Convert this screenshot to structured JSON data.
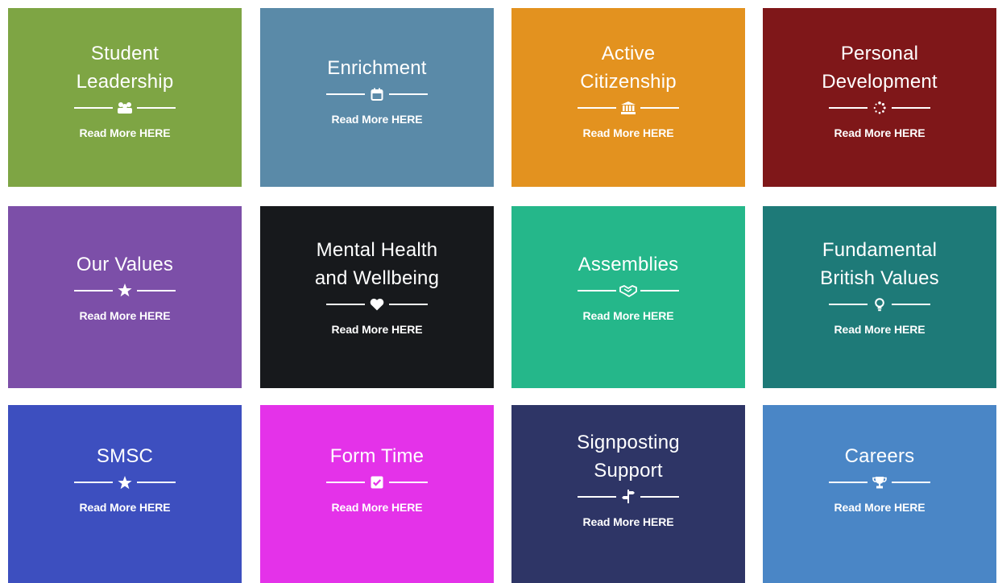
{
  "tiles": [
    {
      "title_lines": [
        "Student",
        "Leadership"
      ],
      "icon": "people-icon",
      "link": "Read More HERE",
      "color": "#7EA544"
    },
    {
      "title_lines": [
        "Enrichment"
      ],
      "icon": "calendar-icon",
      "link": "Read More HERE",
      "color": "#5A8AA8"
    },
    {
      "title_lines": [
        "Active",
        "Citizenship"
      ],
      "icon": "bank-icon",
      "link": "Read More HERE",
      "color": "#E3921F"
    },
    {
      "title_lines": [
        "Personal",
        "Development"
      ],
      "icon": "spinner-icon",
      "link": "Read More HERE",
      "color": "#7F1719"
    },
    {
      "title_lines": [
        "Our Values"
      ],
      "icon": "star-icon",
      "link": "Read More HERE",
      "color": "#7C4FA8"
    },
    {
      "title_lines": [
        "Mental Health",
        "and Wellbeing"
      ],
      "icon": "heart-icon",
      "link": "Read More HERE",
      "color": "#17191C"
    },
    {
      "title_lines": [
        "Assemblies"
      ],
      "icon": "handshake-icon",
      "link": "Read More HERE",
      "color": "#25B78A"
    },
    {
      "title_lines": [
        "Fundamental",
        "British Values"
      ],
      "icon": "lightbulb-icon",
      "link": "Read More HERE",
      "color": "#1E7A78"
    },
    {
      "title_lines": [
        "SMSC"
      ],
      "icon": "star-icon",
      "link": "Read More HERE",
      "color": "#3D4FBF"
    },
    {
      "title_lines": [
        "Form Time"
      ],
      "icon": "checkbox-icon",
      "link": "Read More HERE",
      "color": "#E432E9"
    },
    {
      "title_lines": [
        "Signposting",
        "Support"
      ],
      "icon": "signpost-icon",
      "link": "Read More HERE",
      "color": "#2E3566"
    },
    {
      "title_lines": [
        "Careers"
      ],
      "icon": "trophy-icon",
      "link": "Read More HERE",
      "color": "#4A86C6"
    }
  ]
}
